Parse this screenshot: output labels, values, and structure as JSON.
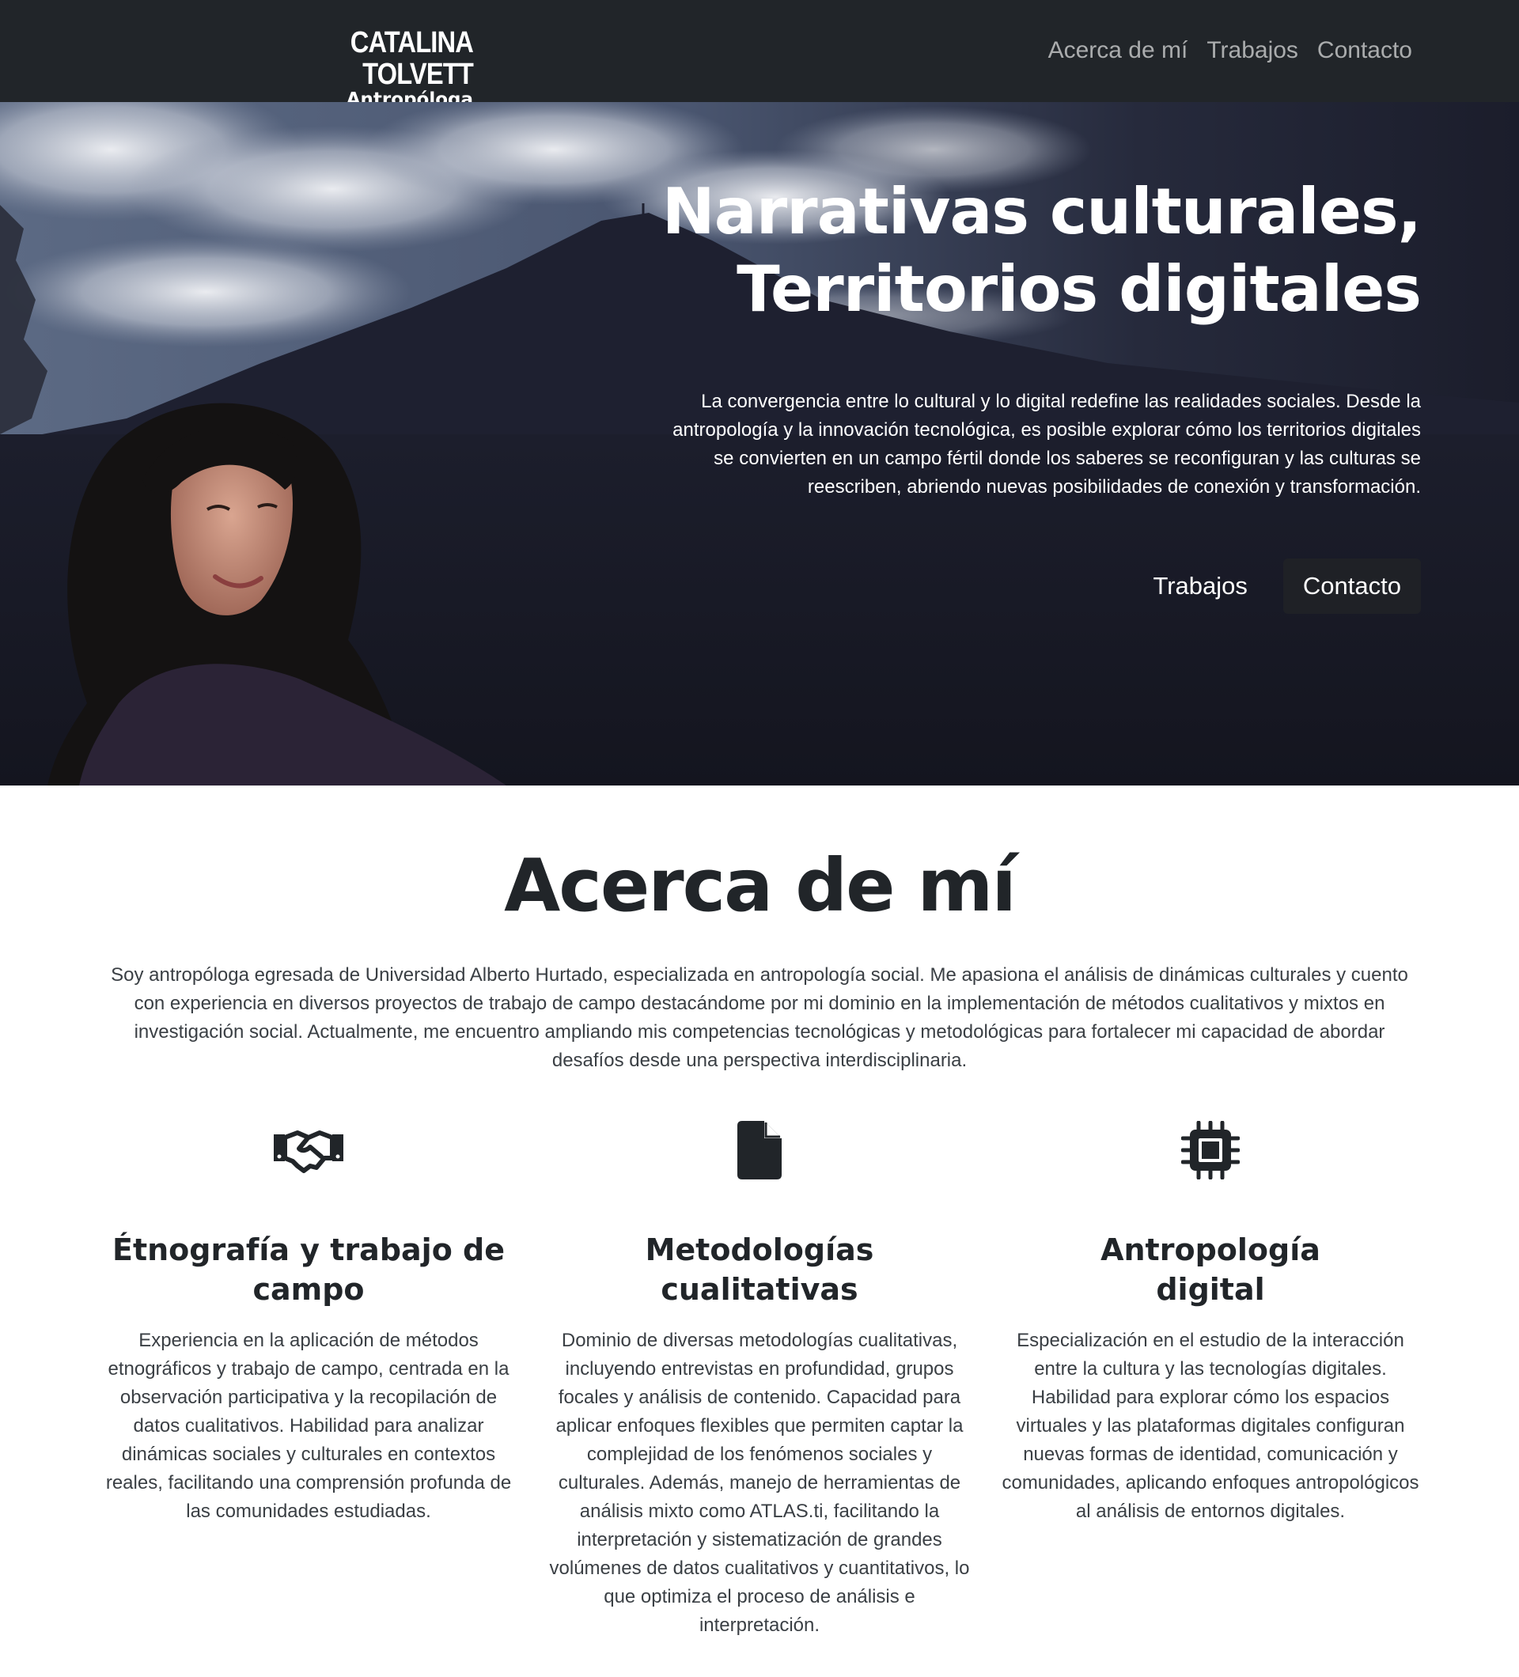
{
  "brand": {
    "name": "CATALINA TOLVETT",
    "subtitle": "Antropóloga"
  },
  "nav": {
    "items": [
      "Acerca de mí",
      "Trabajos",
      "Contacto"
    ]
  },
  "hero": {
    "title_line1": "Narrativas culturales,",
    "title_line2": "Territorios digitales",
    "text": "La convergencia entre lo cultural y lo digital redefine las realidades sociales. Desde la antropología y la innovación tecnológica, es posible explorar cómo los territorios digitales se convierten en un campo fértil donde los saberes se reconfiguran y las culturas se reescriben, abriendo nuevas posibilidades de conexión y transformación.",
    "buttons": {
      "works": "Trabajos",
      "contact": "Contacto"
    }
  },
  "about": {
    "title": "Acerca de mí",
    "text": "Soy antropóloga egresada de Universidad Alberto Hurtado, especializada en antropología social. Me apasiona el análisis de dinámicas culturales y cuento con experiencia en diversos proyectos de trabajo de campo destacándome por mi dominio en la implementación de métodos cualitativos y mixtos en investigación social. Actualmente, me encuentro ampliando mis competencias tecnológicas y metodológicas para fortalecer mi capacidad de abordar desafíos desde una perspectiva interdisciplinaria.",
    "features": [
      {
        "icon": "handshake-icon",
        "title_line1": "Étnografía y trabajo de",
        "title_line2": "campo",
        "text": "Experiencia en la aplicación de métodos etnográficos y trabajo de campo, centrada en la observación participativa y la recopilación de datos cualitativos. Habilidad para analizar dinámicas sociales y culturales en contextos reales, facilitando una comprensión profunda de las comunidades estudiadas."
      },
      {
        "icon": "file-icon",
        "title_line1": "Metodologías",
        "title_line2": "cualitativas",
        "text": "Dominio de diversas metodologías cualitativas, incluyendo entrevistas en profundidad, grupos focales y análisis de contenido. Capacidad para aplicar enfoques flexibles que permiten captar la complejidad de los fenómenos sociales y culturales. Además, manejo de herramientas de análisis mixto como ATLAS.ti, facilitando la interpretación y sistematización de grandes volúmenes de datos cualitativos y cuantitativos, lo que optimiza el proceso de análisis e interpretación."
      },
      {
        "icon": "cpu-chip-icon",
        "title_line1": "Antropología",
        "title_line2": "digital",
        "text": "Especialización en el estudio de la interacción entre la cultura y las tecnologías digitales. Habilidad para explorar cómo los espacios virtuales y las plataformas digitales configuran nuevas formas de identidad, comunicación y comunidades, aplicando enfoques antropológicos al análisis de entornos digitales."
      }
    ]
  },
  "colors": {
    "navbar": "#212529",
    "button_dark": "#1f2126",
    "heading": "#212529",
    "body_text": "#3a3f44"
  }
}
